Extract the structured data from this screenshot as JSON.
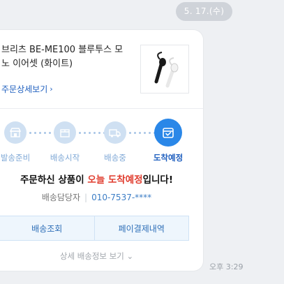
{
  "date_pill": "5. 17.(수)",
  "card": {
    "product_name": "브리츠 BE-ME100 블루투스 모노 이어셋 (화이트)",
    "order_detail_link": "주문상세보기",
    "steps": [
      {
        "label": "발송준비",
        "icon": "store-icon"
      },
      {
        "label": "배송시작",
        "icon": "box-icon"
      },
      {
        "label": "배송중",
        "icon": "truck-icon"
      },
      {
        "label": "도착예정",
        "icon": "shopping-bag-check-icon",
        "active": true
      }
    ],
    "headline": {
      "prefix": "주문하신 상품이 ",
      "highlight": "오늘 도착예정",
      "suffix": "입니다!"
    },
    "courier": {
      "label": "배송담당자",
      "phone": "010-7537-****"
    },
    "buttons": {
      "track": "배송조회",
      "payment": "페이결제내역"
    },
    "more_link": "상세 배송정보 보기"
  },
  "timestamp": "오후 3:29",
  "colors": {
    "accent": "#2a87e8",
    "highlight_red": "#e03c2e",
    "link_blue": "#1f5fbf"
  }
}
